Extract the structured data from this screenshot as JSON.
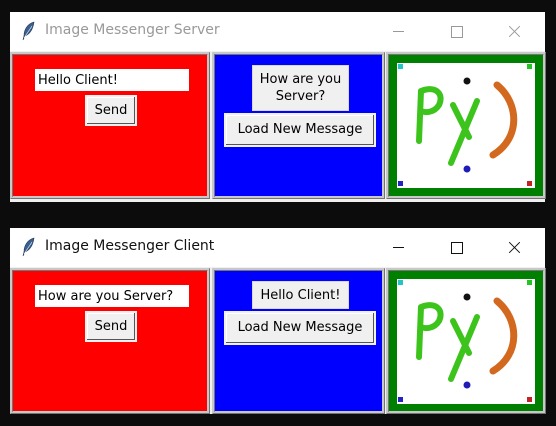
{
  "server_window": {
    "title": "Image Messenger Server",
    "entry_value": "Hello Client!",
    "send_label": "Send",
    "received_message": "How are you Server?",
    "load_label": "Load New Message",
    "icons": [
      "feather-icon",
      "minimize-icon",
      "maximize-icon",
      "close-icon"
    ]
  },
  "client_window": {
    "title": "Image Messenger Client",
    "entry_value": "How are you Server?",
    "send_label": "Send",
    "received_message": "Hello Client!",
    "load_label": "Load New Message",
    "icons": [
      "feather-icon",
      "minimize-icon",
      "maximize-icon",
      "close-icon"
    ]
  },
  "image_text": "Py)",
  "colors": {
    "left_frame": "#ff0000",
    "middle_frame": "#0000ff",
    "right_frame": "#008000",
    "image_letters": "#3cc41c",
    "image_smile": "#d2691e",
    "image_eye_top": "#111111",
    "image_eye_bottom": "#1e1eb4",
    "desktop": "#0c0c0c"
  }
}
